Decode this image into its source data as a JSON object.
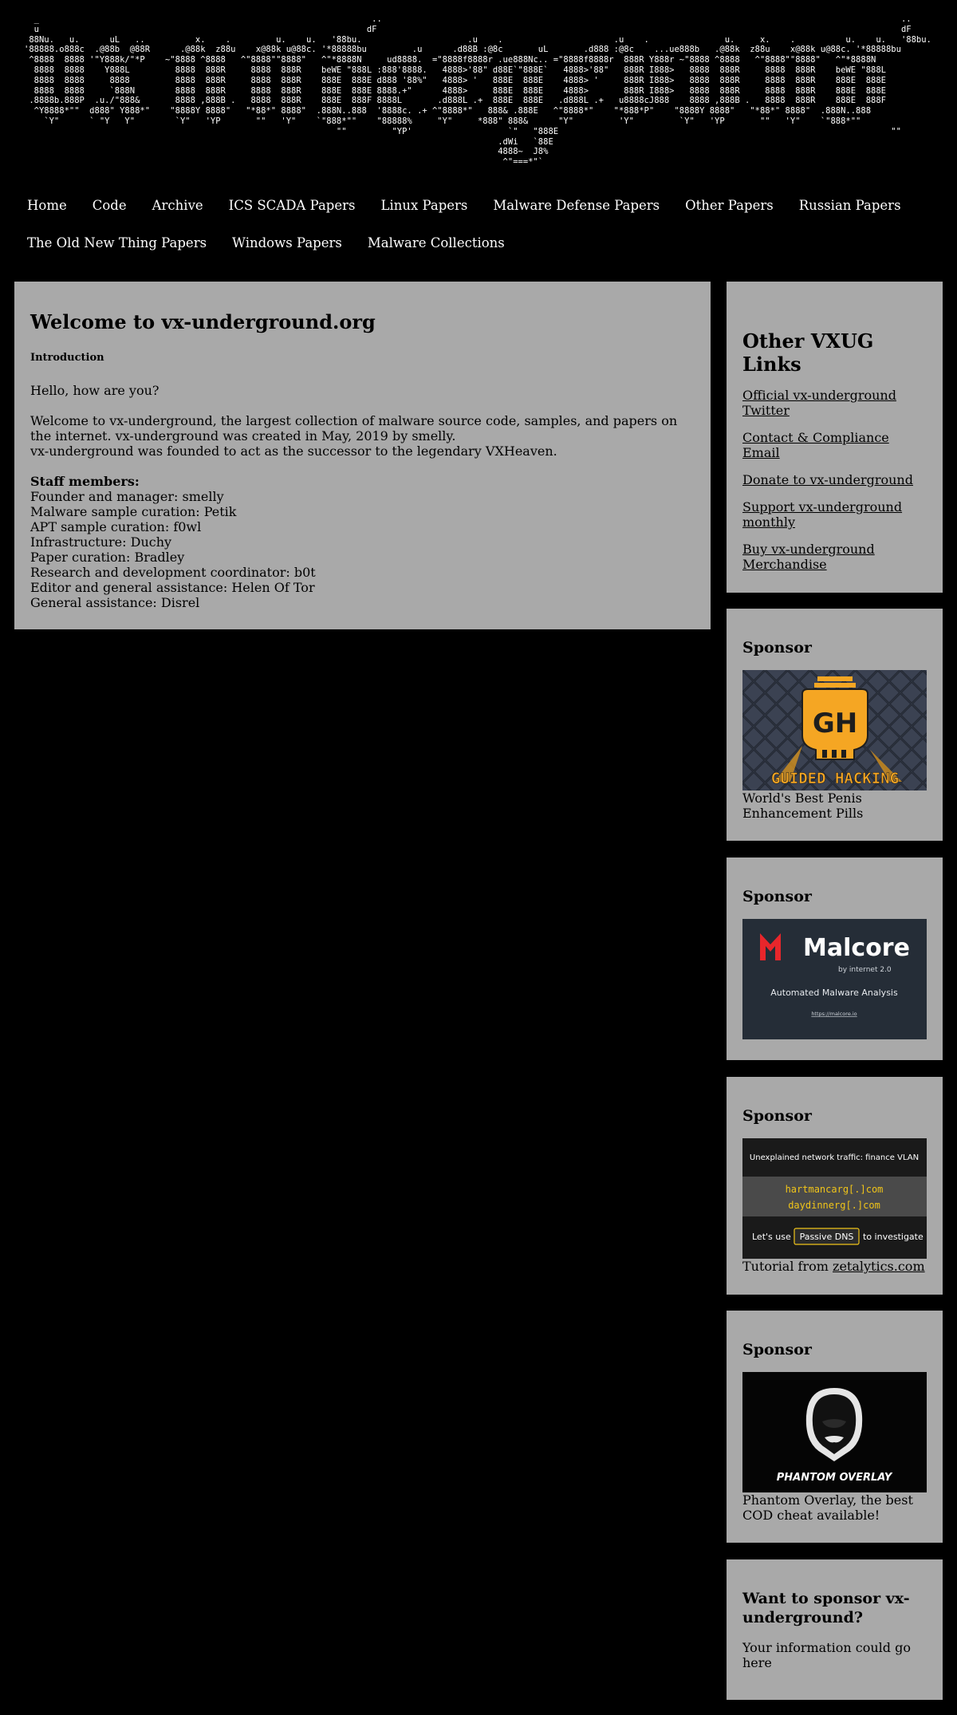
{
  "banner": {
    "ascii_art": "  _                                                                  ..                                                                                                       ..\n  u                                                                 dF                                                                                                        dF\n 88Nu.   u.      uL   ..          x.    .         u.    u.   '88bu.                     .u    .                      .u    .               u.     x.    .          u.    u.   '88bu.\n'88888.o888c  .@88b  @88R      .@88k  z88u    x@88k u@88c. '*88888bu         .u      .d88B :@8c       uL       .d888 :@8c    ...ue888b   .@88k  z88u    x@88k u@88c. '*88888bu\n ^8888  8888 '\"Y888k/\"*P    ~\"8888 ^8888   ^\"8888\"\"8888\"   ^\"*8888N     ud8888.  =\"8888f8888r .ue888Nc.. =\"8888f8888r  888R Y888r ~\"8888 ^8888   ^\"8888\"\"8888\"   ^\"*8888N\n  8888  8888    Y888L         8888  888R     8888  888R    beWE \"888L :888'8888.   4888>'88\" d88E`\"888E`   4888>'88\"   888R I888>   8888  888R     8888  888R    beWE \"888L\n  8888  8888     8888         8888  888R     8888  888R    888E  888E d888 '88%\"   4888> '   888E  888E    4888> '     888R I888>   8888  888R     8888  888R    888E  888E\n  8888  8888     `888N        8888  888R     8888  888R    888E  888E 8888.+\"      4888>     888E  888E    4888>       888R I888>   8888  888R     8888  888R    888E  888E\n .8888b.888P  .u./\"888&       8888 ,888B .   8888  888R    888E  888F 8888L       .d888L .+  888E  888E   .d888L .+   u8888cJ888    8888 ,888B .   8888  888R    888E  888F\n  ^Y8888*\"\"  d888\" Y888*\"    \"8888Y 8888\"   \"*88*\" 8888\"  .888N..888  '8888c. .+ ^\"8888*\"   888& .888E   ^\"8888*\"    \"*888*P\"    \"8888Y 8888\"   \"*88*\" 8888\"  .888N..888\n    `Y\"      ` \"Y   Y\"        `Y\"   'YP       \"\"   'Y\"    `\"888*\"\"    \"88888%     \"Y\"     *888\" 888&      \"Y\"         'Y\"         `Y\"   'YP       \"\"   'Y\"    `\"888*\"\"\n                                                              \"\"         \"YP'                   `\"   \"888E                                                                  \"\"\n                                                                                              .dWi   `88E\n                                                                                              4888~  J8%\n                                                                                               ^\"===*\"`"
  },
  "nav": {
    "row1": [
      "Home",
      "Code",
      "Archive",
      "ICS SCADA Papers",
      "Linux Papers",
      "Malware Defense Papers",
      "Other Papers",
      "Russian Papers"
    ],
    "row2": [
      "The Old New Thing Papers",
      "Windows Papers",
      "Malware Collections"
    ]
  },
  "main": {
    "title": "Welcome to vx-underground.org",
    "intro_heading": "Introduction",
    "greeting": "Hello, how are you?",
    "welcome_1": "Welcome to vx-underground, the largest collection of malware source code, samples, and papers on the internet. vx-underground was created in May, 2019 by smelly.",
    "welcome_2": "vx-underground was founded to act as the successor to the legendary VXHeaven.",
    "staff_title": "Staff members:",
    "staff": [
      "Founder and manager: smelly",
      "Malware sample curation: Petik",
      "APT sample curation: f0wl",
      "Infrastructure: Duchy",
      "Paper curation: Bradley",
      "Research and development coordinator: b0t",
      "Editor and general assistance: Helen Of Tor",
      "General assistance: Disrel"
    ]
  },
  "sidebar": {
    "links_title": "Other VXUG Links",
    "links": [
      "Official vx-underground Twitter",
      "Contact & Compliance Email",
      "Donate to vx-underground",
      "Support vx-underground monthly",
      "Buy vx-underground Merchandise"
    ],
    "sponsor_heading": "Sponsor",
    "sponsor1": {
      "logo_text": "GH",
      "banner_text": "GUIDED HACKING",
      "caption": "World's Best Penis Enhancement Pills"
    },
    "sponsor2": {
      "logo_text": "Malcore",
      "by_text": "by internet 2.0",
      "tagline": "Automated Malware Analysis",
      "url": "https://malcore.io"
    },
    "sponsor3": {
      "top_text": "Unexplained network traffic: finance VLAN",
      "domain1": "hartmancarg[.]com",
      "domain2": "daydinnerg[.]com",
      "bottom_pre": "Let's use",
      "bottom_btn": "Passive DNS",
      "bottom_post": "to investigate",
      "caption_pre": "Tutorial from ",
      "caption_link": "zetalytics.com"
    },
    "sponsor4": {
      "banner_text": "PHANTOM OVERLAY",
      "caption": "Phantom Overlay, the best COD cheat available!"
    },
    "want_title": "Want to sponsor vx-underground?",
    "want_text": "Your information could go here"
  },
  "colors": {
    "background": "#000000",
    "panel": "#a9a9a9",
    "nav_text": "#ffffff",
    "gh_orange": "#f5a623",
    "malcore_red": "#e8262b",
    "zetalytics_yellow": "#f0c419"
  }
}
